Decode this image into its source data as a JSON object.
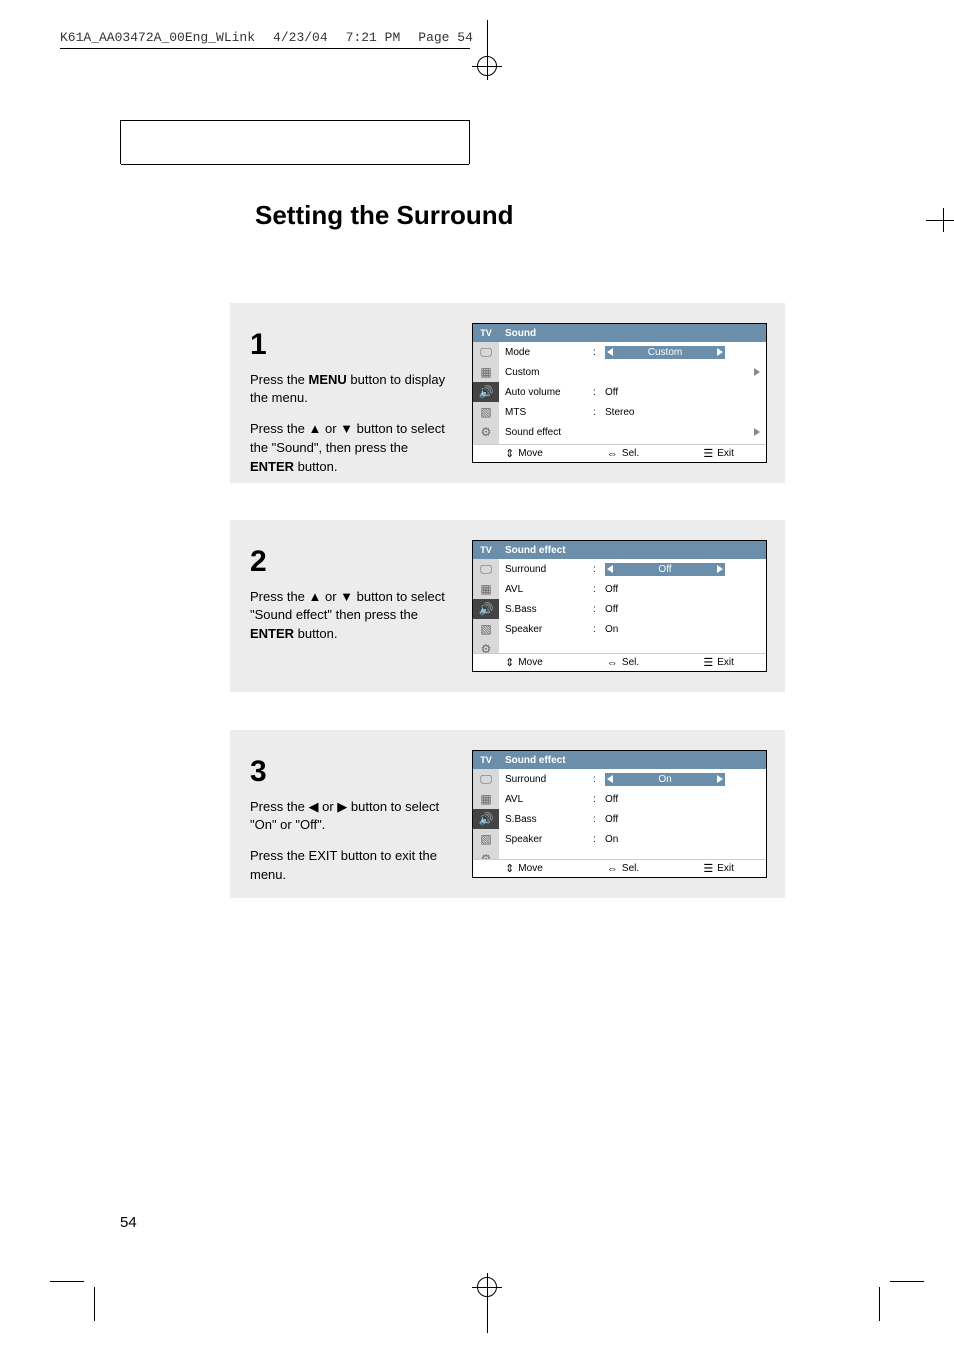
{
  "print_header": {
    "file": "K61A_AA03472A_00Eng_WLink",
    "date": "4/23/04",
    "time": "7:21 PM",
    "page_label": "Page 54"
  },
  "title": "Setting the Surround",
  "page_number": "54",
  "steps": {
    "s1": {
      "num": "1",
      "p1a": "Press the ",
      "p1b": "MENU",
      "p1c": " button to display the menu.",
      "p2a": "Press the ▲ or ▼ button to select the \"Sound\", then press the ",
      "p2b": "ENTER",
      "p2c": " button."
    },
    "s2": {
      "num": "2",
      "p1a": "Press the ▲ or ▼ button to select \"Sound effect\" then press the ",
      "p1b": "ENTER",
      "p1c": " button."
    },
    "s3": {
      "num": "3",
      "p1": "Press the ◀ or ▶ button to select \"On\" or \"Off\".",
      "p2": "Press the EXIT button to exit the menu."
    }
  },
  "osd": {
    "tv": "TV",
    "header1": "Sound",
    "header2": "Sound effect",
    "rows1": {
      "mode": {
        "label": "Mode",
        "value": "Custom"
      },
      "custom": {
        "label": "Custom",
        "value": ""
      },
      "auto_volume": {
        "label": "Auto volume",
        "value": "Off"
      },
      "mts": {
        "label": "MTS",
        "value": "Stereo"
      },
      "sound_effect": {
        "label": "Sound effect",
        "value": ""
      }
    },
    "rows2": {
      "surround": {
        "label": "Surround",
        "value": "Off"
      },
      "avl": {
        "label": "AVL",
        "value": "Off"
      },
      "s_bass": {
        "label": "S.Bass",
        "value": "Off"
      },
      "speaker": {
        "label": "Speaker",
        "value": "On"
      }
    },
    "rows3": {
      "surround": {
        "label": "Surround",
        "value": "On"
      },
      "avl": {
        "label": "AVL",
        "value": "Off"
      },
      "s_bass": {
        "label": "S.Bass",
        "value": "Off"
      },
      "speaker": {
        "label": "Speaker",
        "value": "On"
      }
    },
    "footer": {
      "move": "Move",
      "sel": "Sel.",
      "exit": "Exit"
    },
    "icons": {
      "updown": "◆",
      "leftright": "◀▶",
      "menu": "▭"
    }
  }
}
